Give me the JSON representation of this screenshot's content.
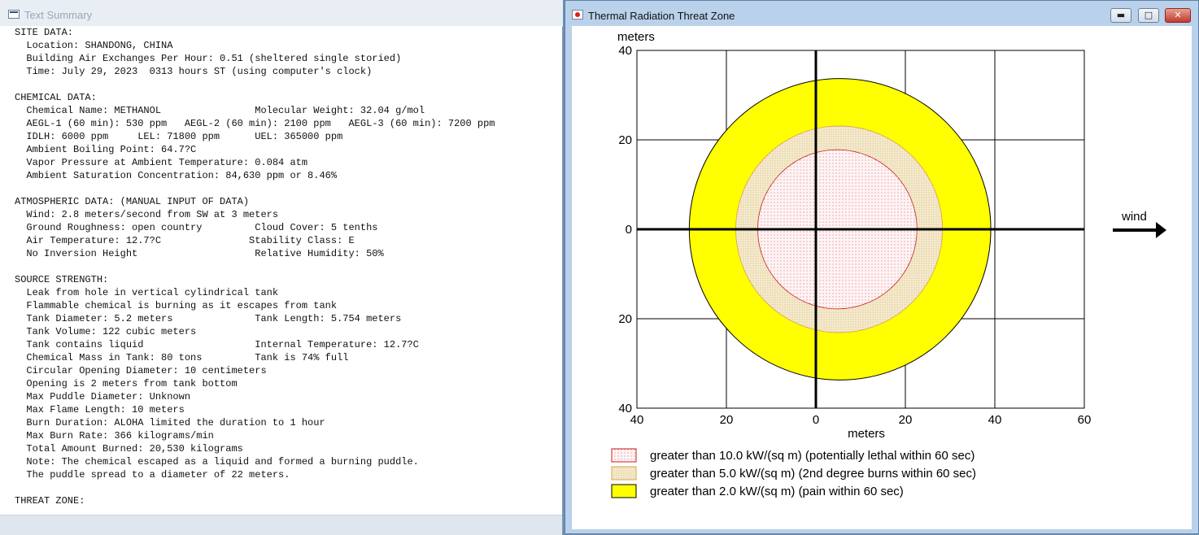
{
  "summary_window": {
    "title": "Text Summary",
    "lines": [
      "SITE DATA:",
      "  Location: SHANDONG, CHINA",
      "  Building Air Exchanges Per Hour: 0.51 (sheltered single storied)",
      "  Time: July 29, 2023  0313 hours ST (using computer's clock)",
      "",
      "CHEMICAL DATA:",
      "  Chemical Name: METHANOL                Molecular Weight: 32.04 g/mol",
      "  AEGL-1 (60 min): 530 ppm   AEGL-2 (60 min): 2100 ppm   AEGL-3 (60 min): 7200 ppm",
      "  IDLH: 6000 ppm     LEL: 71800 ppm      UEL: 365000 ppm",
      "  Ambient Boiling Point: 64.7?C",
      "  Vapor Pressure at Ambient Temperature: 0.084 atm",
      "  Ambient Saturation Concentration: 84,630 ppm or 8.46%",
      "",
      "ATMOSPHERIC DATA: (MANUAL INPUT OF DATA)",
      "  Wind: 2.8 meters/second from SW at 3 meters",
      "  Ground Roughness: open country         Cloud Cover: 5 tenths",
      "  Air Temperature: 12.7?C               Stability Class: E",
      "  No Inversion Height                    Relative Humidity: 50%",
      "",
      "SOURCE STRENGTH:",
      "  Leak from hole in vertical cylindrical tank",
      "  Flammable chemical is burning as it escapes from tank",
      "  Tank Diameter: 5.2 meters              Tank Length: 5.754 meters",
      "  Tank Volume: 122 cubic meters",
      "  Tank contains liquid                   Internal Temperature: 12.7?C",
      "  Chemical Mass in Tank: 80 tons         Tank is 74% full",
      "  Circular Opening Diameter: 10 centimeters",
      "  Opening is 2 meters from tank bottom",
      "  Max Puddle Diameter: Unknown",
      "  Max Flame Length: 10 meters",
      "  Burn Duration: ALOHA limited the duration to 1 hour",
      "  Max Burn Rate: 366 kilograms/min",
      "  Total Amount Burned: 20,530 kilograms",
      "  Note: The chemical escaped as a liquid and formed a burning puddle.",
      "  The puddle spread to a diameter of 22 meters.",
      "",
      "THREAT ZONE:"
    ]
  },
  "threat_window": {
    "title": "Thermal Radiation Threat Zone",
    "minimize_glyph": "▬",
    "maximize_glyph": "□",
    "close_glyph": "✕"
  },
  "chart_data": {
    "type": "threat-zone-plot",
    "ylabel": "meters",
    "xlabel": "meters",
    "x_ticks": [
      "40",
      "20",
      "0",
      "20",
      "40",
      "60"
    ],
    "y_ticks": [
      "40",
      "20",
      "0",
      "20",
      "40"
    ],
    "xlim": [
      -40,
      60
    ],
    "ylim": [
      -40,
      40
    ],
    "wind_label": "wind",
    "zones": [
      {
        "threshold": "greater than 2.0 kW/(sq m) (pain within 60 sec)",
        "center_x": 5.4,
        "radius": 33.7,
        "color": "#ffff00",
        "pattern": "solid"
      },
      {
        "threshold": "greater than 5.0 kW/(sq m) (2nd degree burns within 60 sec)",
        "center_x": 5.2,
        "radius": 23.1,
        "color": "#efe6c4",
        "pattern": "dotted-orange"
      },
      {
        "threshold": "greater than 10.0 kW/(sq m) (potentially lethal within 60 sec)",
        "center_x": 4.8,
        "radius": 17.8,
        "color": "#fbeef0",
        "pattern": "dotted-red"
      }
    ],
    "legend": [
      "greater than 10.0 kW/(sq m) (potentially lethal within 60 sec)",
      "greater than 5.0 kW/(sq m) (2nd degree burns within 60 sec)",
      "greater than 2.0 kW/(sq m) (pain within 60 sec)"
    ],
    "grid": true
  }
}
